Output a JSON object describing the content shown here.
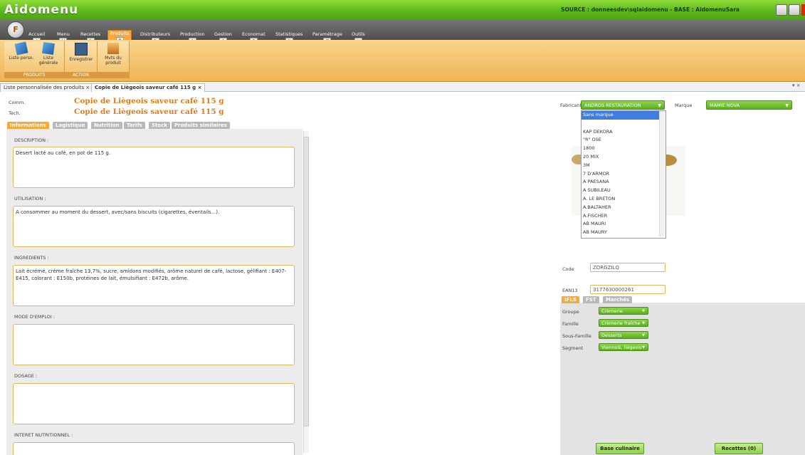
{
  "app": {
    "title": "Aidomenu",
    "source_text": "SOURCE : donneesdev\\sqlaidomenu - BASE : AidomenuSara"
  },
  "ribbon": {
    "tabs": [
      {
        "label": "Accueil",
        "key": "A"
      },
      {
        "label": "Menu",
        "key": "M"
      },
      {
        "label": "Recettes",
        "key": "R"
      },
      {
        "label": "Produits",
        "key": "P"
      },
      {
        "label": "Distributeurs",
        "key": "D"
      },
      {
        "label": "Production",
        "key": "O"
      },
      {
        "label": "Gestion",
        "key": "G"
      },
      {
        "label": "Economat",
        "key": "E"
      },
      {
        "label": "Statistiques",
        "key": "S"
      },
      {
        "label": "Paramétrage",
        "key": "T"
      },
      {
        "label": "Outils",
        "key": "U"
      }
    ],
    "groups": [
      {
        "label": "PRODUITS",
        "buttons": [
          "Liste perso.",
          "Liste générale"
        ]
      },
      {
        "label": "ACTION",
        "buttons": [
          "Enregistrer"
        ]
      },
      {
        "label": "",
        "buttons": [
          "Mvts du produit"
        ]
      }
    ]
  },
  "doc_tabs": [
    {
      "label": "Liste personnalisée des produits",
      "close": "×"
    },
    {
      "label": "Copie de Liègeois saveur café 115 g",
      "close": "×"
    }
  ],
  "panel_controls": "▾ ×",
  "product": {
    "comm_label": "Comm.",
    "tech_label": "Tech.",
    "comm_name": "Copie de Liègeois saveur café 115 g",
    "tech_name": "Copie de Liègeois saveur café 115 g"
  },
  "info_tabs": [
    "Informations",
    "Logistique",
    "Nutrition",
    "Tarifs",
    "Stock",
    "Produits similaires"
  ],
  "sections": [
    {
      "label": "DESCRIPTION :",
      "value": "Desert lacté au café, en pot de 115 g."
    },
    {
      "label": "UTILISATION :",
      "value": "A consommer au moment du dessert, avec/sans biscuits (cigarettes, éventails...)."
    },
    {
      "label": "INGREDIENTS :",
      "value": "Lait écrémé, crème fraîche 13,7%, sucre, amidons modifiés, arôme naturel de café, lactose, gélifiant : E407-E415, colorant : E150b, protéines de lait, émulsifiant : E472b, arôme."
    },
    {
      "label": "MODE D'EMPLOI :",
      "value": ""
    },
    {
      "label": "DOSAGE :",
      "value": ""
    },
    {
      "label": "INTERET NUTRITIONNEL :",
      "value": ""
    }
  ],
  "fabricant": {
    "label": "Fabricant",
    "value": "ANDROS RESTAURATION",
    "options": [
      "Sans marque",
      "",
      "KAP DEKORA",
      "\"R\" OSE",
      "1800",
      "20 MIX",
      "3M",
      "7 D'ARMOR",
      "A PAESANA",
      "A SUBILEAU",
      "A. LE BRETON",
      "A.BALTAHER",
      "A.FISCHER",
      "AB MAURI",
      "AB MAURY"
    ]
  },
  "marque": {
    "label": "Marque",
    "value": "MAMIE NOVA"
  },
  "code": {
    "label": "Code",
    "value": "ZORGZILQ"
  },
  "ean13": {
    "label": "EAN13",
    "value": "3177630000261"
  },
  "classif_tabs": [
    "IFLS",
    "FST",
    "Marchés"
  ],
  "classif": [
    {
      "label": "Groupe",
      "value": "Crèmerie"
    },
    {
      "label": "Famille",
      "value": "Crèmerie fraîche"
    },
    {
      "label": "Sous-Famille",
      "value": "Desserts"
    },
    {
      "label": "Segment",
      "value": "Viennois, liégeois"
    }
  ],
  "buttons": {
    "base_culinaire": "Base culinaire",
    "recettes": "Recettes (0)"
  },
  "colors": {
    "accent": "#f7a93a",
    "titlebar": "#5cb81c",
    "combo": "#6fc02e"
  }
}
